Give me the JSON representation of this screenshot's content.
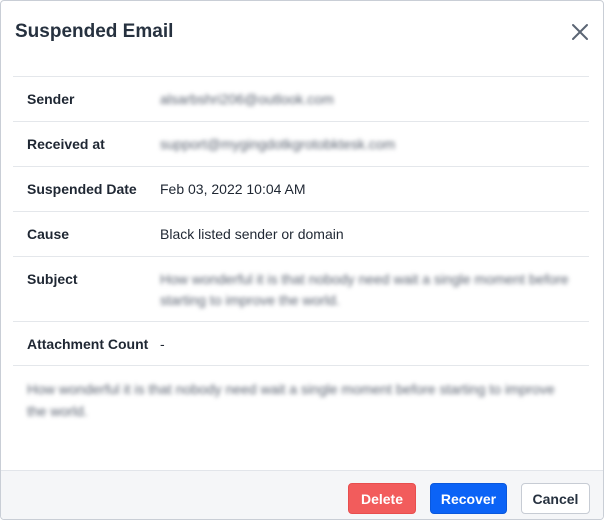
{
  "dialog": {
    "title": "Suspended Email",
    "close_icon": "close-icon"
  },
  "fields": [
    {
      "label": "Sender",
      "value": "alsarbshri206@outlook.com"
    },
    {
      "label": "Received at",
      "value": "support@mygingdotkgrotobktesk.com"
    },
    {
      "label": "Suspended Date",
      "value": "Feb 03, 2022 10:04 AM"
    },
    {
      "label": "Cause",
      "value": "Black listed sender or domain"
    },
    {
      "label": "Subject",
      "value": "How wonderful it is that nobody need wait a single moment before starting to improve the world."
    },
    {
      "label": "Attachment Count",
      "value": "-"
    }
  ],
  "body": "How wonderful it is that nobody need wait a single moment before starting to improve the world.",
  "footer": {
    "delete_label": "Delete",
    "recover_label": "Recover",
    "cancel_label": "Cancel"
  },
  "colors": {
    "delete": "#f25c5c",
    "recover": "#0b63f6",
    "footer_bg": "#f5f6f8"
  }
}
